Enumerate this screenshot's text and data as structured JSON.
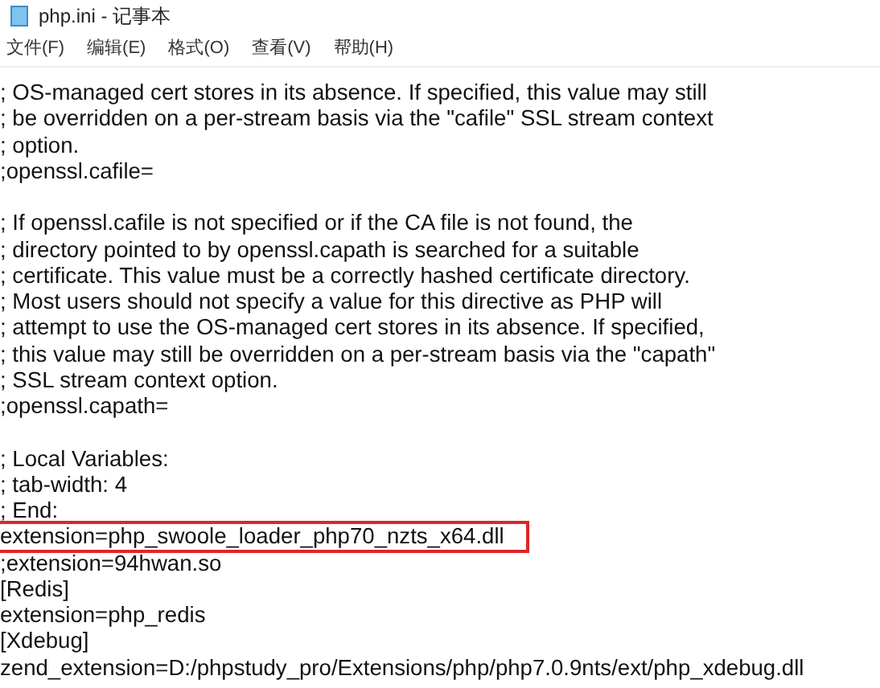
{
  "window": {
    "title": "php.ini - 记事本"
  },
  "menu": [
    "文件(F)",
    "编辑(E)",
    "格式(O)",
    "查看(V)",
    "帮助(H)"
  ],
  "lines": [
    {
      "kind": "text",
      "text": "; OS-managed cert stores in its absence. If specified, this value may still",
      "highlighted": false
    },
    {
      "kind": "text",
      "text": "; be overridden on a per-stream basis via the \"cafile\" SSL stream context",
      "highlighted": false
    },
    {
      "kind": "text",
      "text": "; option.",
      "highlighted": false
    },
    {
      "kind": "text",
      "text": ";openssl.cafile=",
      "highlighted": false
    },
    {
      "kind": "blank"
    },
    {
      "kind": "text",
      "text": "; If openssl.cafile is not specified or if the CA file is not found, the",
      "highlighted": false
    },
    {
      "kind": "text",
      "text": "; directory pointed to by openssl.capath is searched for a suitable",
      "highlighted": false
    },
    {
      "kind": "text",
      "text": "; certificate. This value must be a correctly hashed certificate directory.",
      "highlighted": false
    },
    {
      "kind": "text",
      "text": "; Most users should not specify a value for this directive as PHP will",
      "highlighted": false
    },
    {
      "kind": "text",
      "text": "; attempt to use the OS-managed cert stores in its absence. If specified,",
      "highlighted": false
    },
    {
      "kind": "text",
      "text": "; this value may still be overridden on a per-stream basis via the \"capath\"",
      "highlighted": false
    },
    {
      "kind": "text",
      "text": "; SSL stream context option.",
      "highlighted": false
    },
    {
      "kind": "text",
      "text": ";openssl.capath=",
      "highlighted": false
    },
    {
      "kind": "blank"
    },
    {
      "kind": "text",
      "text": "; Local Variables:",
      "highlighted": false
    },
    {
      "kind": "text",
      "text": "; tab-width: 4",
      "highlighted": false
    },
    {
      "kind": "text",
      "text": "; End:",
      "highlighted": false
    },
    {
      "kind": "text",
      "text": "extension=php_swoole_loader_php70_nzts_x64.dll",
      "highlighted": true
    },
    {
      "kind": "text",
      "text": ";extension=94hwan.so",
      "highlighted": false
    },
    {
      "kind": "text",
      "text": "[Redis]",
      "highlighted": false
    },
    {
      "kind": "text",
      "text": "extension=php_redis",
      "highlighted": false
    },
    {
      "kind": "text",
      "text": "[Xdebug]",
      "highlighted": false
    },
    {
      "kind": "text",
      "text": "zend_extension=D:/phpstudy_pro/Extensions/php/php7.0.9nts/ext/php_xdebug.dll",
      "highlighted": false
    }
  ]
}
